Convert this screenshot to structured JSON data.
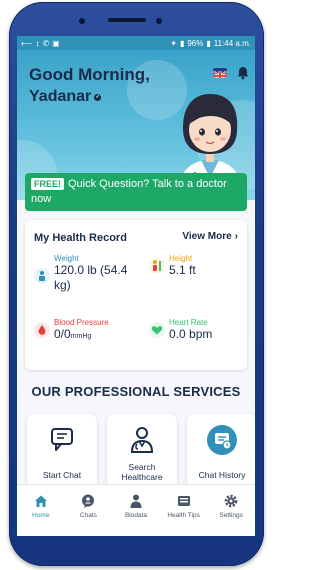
{
  "status_bar": {
    "right_text": "96%",
    "time": "11:44 a.m."
  },
  "header": {
    "greeting": "Good Morning,",
    "user_name": "Yadanar"
  },
  "banner": {
    "badge": "FREE!",
    "text": "Quick Question? Talk to a doctor now"
  },
  "health_record": {
    "title": "My Health Record",
    "view_more": "View More",
    "weight": {
      "label": "Weight",
      "value": "120.0 lb (54.4 kg)"
    },
    "height": {
      "label": "Height",
      "value": "5.1 ft"
    },
    "blood_pressure": {
      "label": "Blood Pressure",
      "value": "0/0",
      "unit": "mmHg"
    },
    "heart_rate": {
      "label": "Heart Rate",
      "value": "0.0 bpm"
    }
  },
  "services": {
    "title": "OUR PROFESSIONAL SERVICES",
    "items": [
      {
        "label": "Start Chat"
      },
      {
        "label": "Search Healthcare Provider"
      },
      {
        "label": "Chat History"
      }
    ]
  },
  "nav": {
    "items": [
      {
        "label": "Home"
      },
      {
        "label": "Chats"
      },
      {
        "label": "Biodata"
      },
      {
        "label": "Health Tips"
      },
      {
        "label": "Settings"
      }
    ]
  },
  "colors": {
    "brand": "#2f90b8",
    "banner_green": "#1ea866",
    "weight": "#2f90b8",
    "height": "#f0a400",
    "blood_pressure": "#e53e3e",
    "heart_rate": "#38c172"
  }
}
